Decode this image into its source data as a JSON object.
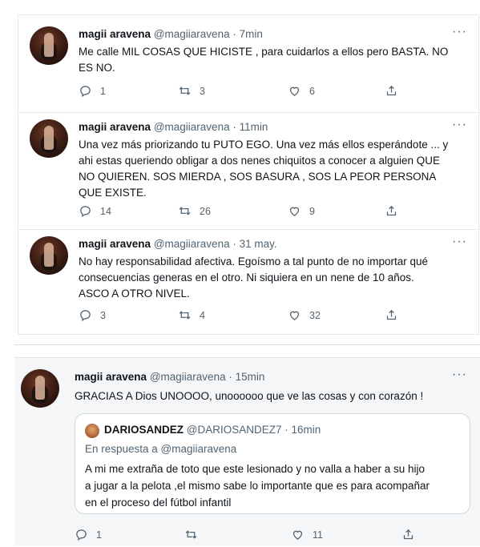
{
  "block1": {
    "tweets": [
      {
        "name": "magii aravena",
        "handle": "@magiiaravena · 7min",
        "more": "···",
        "text_lines": [
          "Me calle MIL COSAS QUE HICISTE , para cuidarlos a ellos pero BASTA. NO",
          "ES NO."
        ],
        "replies": "1",
        "retweets": "3",
        "likes": "6"
      },
      {
        "name": "magii aravena",
        "handle": "@magiiaravena · 11min",
        "more": "···",
        "text_lines": [
          "Una vez más priorizando tu PUTO EGO. Una vez más ellos esperándote  ... y",
          "ahi estas queriendo obligar a dos nenes chiquitos a conocer a alguien QUE",
          "NO QUIEREN. SOS MIERDA , SOS BASURA , SOS LA  PEOR PERSONA",
          "QUE EXISTE."
        ],
        "replies": "14",
        "retweets": "26",
        "likes": "9"
      },
      {
        "name": "magii aravena",
        "handle": "@magiiaravena · 31 may.",
        "more": "···",
        "text_lines": [
          "No hay responsabilidad afectiva. Egoísmo a tal punto de no importar qué",
          "consecuencias generas en el otro.  Ni siquiera en un nene de 10 años.",
          "ASCO A OTRO NIVEL."
        ],
        "replies": "3",
        "retweets": "4",
        "likes": "32"
      }
    ]
  },
  "block2": {
    "name": "magii aravena",
    "handle": "@magiiaravena · 15min",
    "more": "···",
    "text": "GRACIAS A Dios UNOOOO, unoooooo que ve las cosas y con corazón !",
    "quote": {
      "name": "DARIOSANDEZ",
      "handle": "@DARIOSANDEZ7 · 16min",
      "reply_to": "En respuesta a @magiiaravena",
      "text_lines": [
        "A mi me extraña de toto que este lesionado y no valla a haber a su hijo",
        "a jugar a la pelota ,el mismo sabe lo importante que es para acompañar",
        "en el proceso del fútbol infantil"
      ]
    },
    "replies": "1",
    "retweets": "",
    "likes": "11"
  }
}
